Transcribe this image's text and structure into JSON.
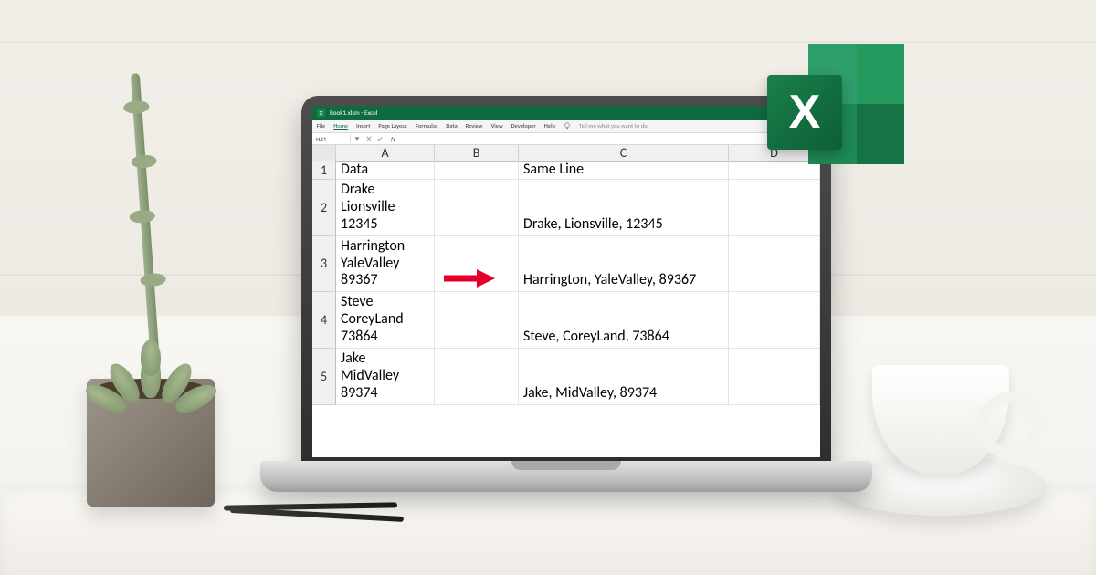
{
  "titlebar": {
    "filename": "Book1.xlsm - Excel"
  },
  "ribbon": {
    "file": "File",
    "home": "Home",
    "insert": "Insert",
    "pagelayout": "Page Layout",
    "formulas": "Formulas",
    "data": "Data",
    "review": "Review",
    "view": "View",
    "developer": "Developer",
    "help": "Help",
    "tellme": "Tell me what you want to do"
  },
  "formula": {
    "namebox": "H41",
    "fx_label": "fx"
  },
  "columns": {
    "A": "A",
    "B": "B",
    "C": "C",
    "D": "D"
  },
  "rows": [
    {
      "num": "1",
      "a": "Data",
      "c": "Same Line",
      "short": true
    },
    {
      "num": "2",
      "a": "Drake\nLionsville\n12345",
      "c": "Drake, Lionsville, 12345"
    },
    {
      "num": "3",
      "a": "Harrington\nYaleValley\n89367",
      "c": "Harrington, YaleValley, 89367"
    },
    {
      "num": "4",
      "a": "Steve\nCoreyLand\n73864",
      "c": "Steve, CoreyLand, 73864"
    },
    {
      "num": "5",
      "a": "Jake\nMidValley\n89374",
      "c": "Jake, MidValley, 89374"
    }
  ],
  "logo": {
    "letter": "X"
  }
}
